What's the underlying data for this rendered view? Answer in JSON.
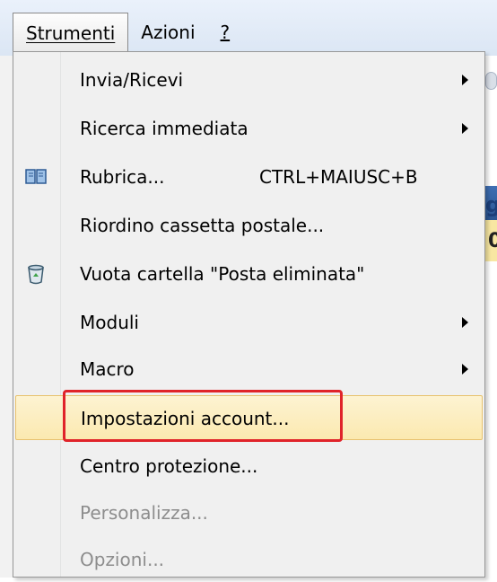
{
  "menubar": {
    "items": [
      {
        "label": "Strumenti",
        "active": true
      },
      {
        "label": "Azioni",
        "active": false
      },
      {
        "label": "?",
        "active": false
      }
    ]
  },
  "menu": {
    "items": [
      {
        "label": "Invia/Ricevi",
        "submenu": true,
        "icon": "",
        "disabled": false
      },
      {
        "label": "Ricerca immediata",
        "submenu": true,
        "icon": "",
        "disabled": false
      },
      {
        "label": "Rubrica...",
        "shortcut": "CTRL+MAIUSC+B",
        "icon": "address-book-icon",
        "disabled": false
      },
      {
        "label": "Riordino cassetta postale...",
        "icon": "",
        "disabled": false
      },
      {
        "label": "Vuota cartella \"Posta eliminata\"",
        "icon": "recycle-bin-icon",
        "disabled": false
      },
      {
        "label": "Moduli",
        "submenu": true,
        "icon": "",
        "disabled": false
      },
      {
        "label": "Macro",
        "submenu": true,
        "icon": "",
        "disabled": false
      },
      {
        "label": "Impostazioni account...",
        "highlighted": true,
        "icon": "",
        "disabled": false
      },
      {
        "label": "Centro protezione...",
        "icon": "",
        "disabled": false
      },
      {
        "label": "Personalizza...",
        "icon": "",
        "disabled": true
      },
      {
        "label": "Opzioni...",
        "icon": "",
        "disabled": true
      }
    ]
  },
  "background": {
    "fragment_1": "g",
    "fragment_2": "0"
  },
  "colors": {
    "highlight_bg": "#fbe9b0",
    "focus_outline": "#e0232a",
    "menu_bg": "#f0f0f0"
  }
}
